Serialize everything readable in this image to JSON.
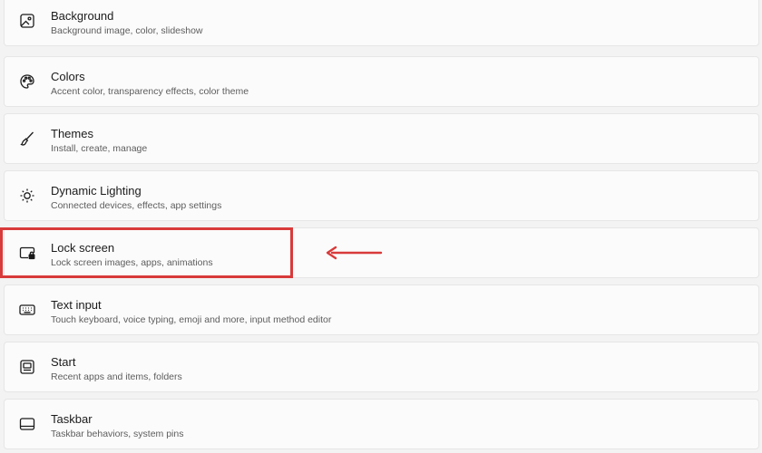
{
  "settings_items": [
    {
      "title": "Background",
      "subtitle": "Background image, color, slideshow",
      "icon": "image-icon"
    },
    {
      "title": "Colors",
      "subtitle": "Accent color, transparency effects, color theme",
      "icon": "palette-icon"
    },
    {
      "title": "Themes",
      "subtitle": "Install, create, manage",
      "icon": "brush-icon"
    },
    {
      "title": "Dynamic Lighting",
      "subtitle": "Connected devices, effects, app settings",
      "icon": "lighting-icon"
    },
    {
      "title": "Lock screen",
      "subtitle": "Lock screen images, apps, animations",
      "icon": "lock-screen-icon"
    },
    {
      "title": "Text input",
      "subtitle": "Touch keyboard, voice typing, emoji and more, input method editor",
      "icon": "keyboard-icon"
    },
    {
      "title": "Start",
      "subtitle": "Recent apps and items, folders",
      "icon": "start-icon"
    },
    {
      "title": "Taskbar",
      "subtitle": "Taskbar behaviors, system pins",
      "icon": "taskbar-icon"
    }
  ],
  "annotation": {
    "highlighted_item": "Lock screen",
    "color": "#d93a3a"
  }
}
